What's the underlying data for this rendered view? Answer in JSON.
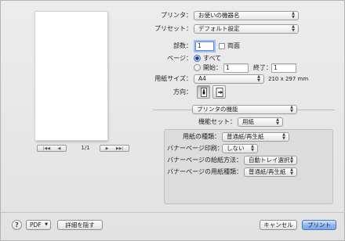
{
  "preview": {
    "page_count": "1/1",
    "first_icon": "first-page-icon",
    "prev_icon": "previous-page-icon",
    "next_icon": "next-page-icon",
    "last_icon": "last-page-icon"
  },
  "printer": {
    "label": "プリンタ：",
    "value": "お使いの機器名"
  },
  "presets": {
    "label": "プリセット：",
    "value": "デフォルト設定"
  },
  "copies": {
    "label": "部数：",
    "value": "1",
    "duplex_label": "両面"
  },
  "pages": {
    "label": "ページ：",
    "all_label": "すべて",
    "from_label": "開始：",
    "from_value": "1",
    "to_label": "終了：",
    "to_value": "1"
  },
  "paper_size": {
    "label": "用紙サイズ：",
    "value": "A4",
    "dimensions": "210 x 297 mm"
  },
  "orientation": {
    "label": "方向：",
    "portrait_icon": "portrait-orientation-icon",
    "landscape_icon": "landscape-orientation-icon"
  },
  "section_popup": {
    "value": "プリンタの機能"
  },
  "feature_set": {
    "label": "機能セット：",
    "value": "用紙"
  },
  "settings": [
    {
      "label": "用紙の種類：",
      "value": "普通紙/再生紙"
    },
    {
      "label": "バナーページ印刷：",
      "value": "しない"
    },
    {
      "label": "バナーページの給紙方法：",
      "value": "自動トレイ選択"
    },
    {
      "label": "バナーページの用紙種類：",
      "value": "普通紙/再生紙"
    }
  ],
  "footer": {
    "help": "?",
    "pdf_label": "PDF",
    "hide_details_label": "詳細を隠す",
    "cancel_label": "キャンセル",
    "print_label": "プリント"
  },
  "colors": {
    "accent": "#79a5ea",
    "focus": "#5b8fdb"
  }
}
